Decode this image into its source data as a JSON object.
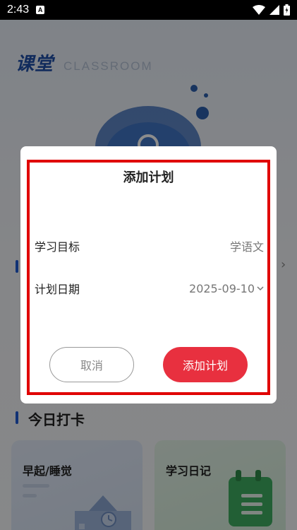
{
  "status_bar": {
    "time": "2:43",
    "notification_badge": "A"
  },
  "header": {
    "brand_cn": "课堂",
    "brand_en": "CLASSROOM"
  },
  "sections": {
    "checkin_title": "今日打卡"
  },
  "cards": [
    {
      "title": "早起/睡觉"
    },
    {
      "title": "学习日记"
    }
  ],
  "dialog": {
    "title": "添加计划",
    "fields": [
      {
        "label": "学习目标",
        "value": "学语文"
      },
      {
        "label": "计划日期",
        "value": "2025-09-10"
      }
    ],
    "cancel_label": "取消",
    "confirm_label": "添加计划"
  },
  "colors": {
    "accent_red": "#e8303f",
    "brand_blue": "#1f4fa8",
    "highlight_frame": "#e00000"
  }
}
